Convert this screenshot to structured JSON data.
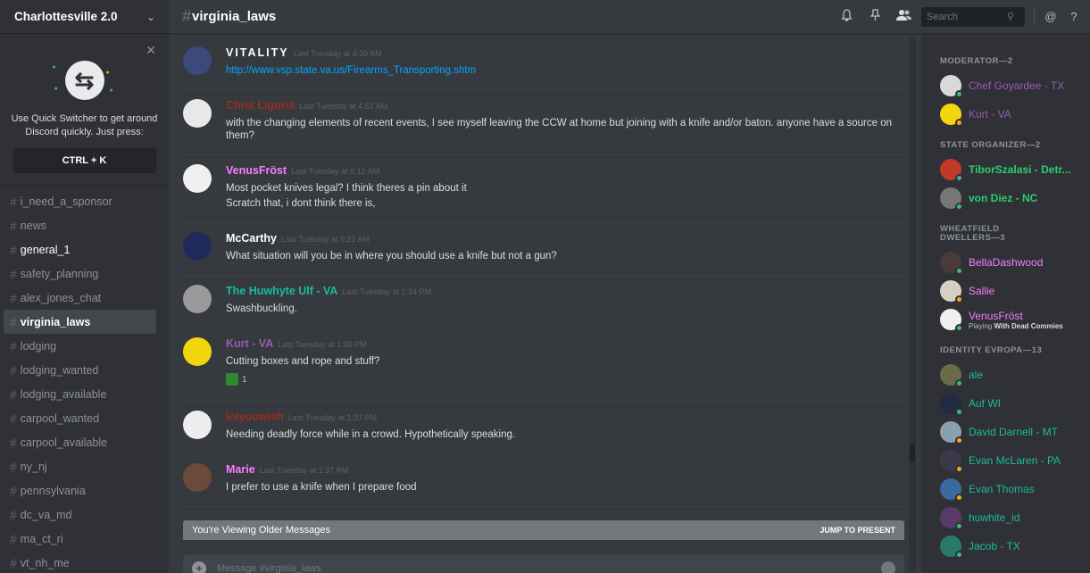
{
  "server": {
    "name": "Charlottesville 2.0"
  },
  "switcher": {
    "text": "Use Quick Switcher to get around Discord quickly. Just press:",
    "shortcut": "CTRL + K"
  },
  "channels": [
    {
      "name": "i_need_a_sponsor",
      "state": "normal"
    },
    {
      "name": "news",
      "state": "normal"
    },
    {
      "name": "general_1",
      "state": "unread"
    },
    {
      "name": "safety_planning",
      "state": "normal"
    },
    {
      "name": "alex_jones_chat",
      "state": "normal"
    },
    {
      "name": "virginia_laws",
      "state": "active"
    },
    {
      "name": "lodging",
      "state": "normal"
    },
    {
      "name": "lodging_wanted",
      "state": "normal"
    },
    {
      "name": "lodging_available",
      "state": "normal"
    },
    {
      "name": "carpool_wanted",
      "state": "normal"
    },
    {
      "name": "carpool_available",
      "state": "normal"
    },
    {
      "name": "ny_nj",
      "state": "normal"
    },
    {
      "name": "pennsylvania",
      "state": "normal"
    },
    {
      "name": "dc_va_md",
      "state": "normal"
    },
    {
      "name": "ma_ct_ri",
      "state": "normal"
    },
    {
      "name": "vt_nh_me",
      "state": "normal"
    }
  ],
  "topbar": {
    "channel": "virginia_laws",
    "search_placeholder": "Search",
    "icons": [
      "bell-icon",
      "pin-icon",
      "members-icon",
      "search-icon",
      "at-icon",
      "help-icon"
    ]
  },
  "messages": [
    {
      "author": "VITALITY",
      "color": "#ffffff",
      "timestamp": "Last Tuesday at 4:39 AM",
      "lines": [],
      "link": "http://www.vsp.state.va.us/Firearms_Transporting.shtm",
      "avatar": "#3b4a7a",
      "spaced": true
    },
    {
      "author": "Chris Liguria",
      "color": "#992d22",
      "timestamp": "Last Tuesday at 4:52 AM",
      "lines": [
        "with the changing elements of recent events, I see myself leaving the CCW at home but joining with a knife and/or baton. anyone have a source on them?"
      ],
      "avatar": "#e8e8e8"
    },
    {
      "author": "VenusFröst",
      "color": "#f47fff",
      "timestamp": "Last Tuesday at 5:12 AM",
      "lines": [
        "Most pocket knives legal? I think theres a pin about it",
        "Scratch that, i dont think there is,"
      ],
      "avatar": "#f0f0f0"
    },
    {
      "author": "McCarthy",
      "color": "#ffffff",
      "timestamp": "Last Tuesday at 5:21 AM",
      "lines": [
        "What situation will you be in where you should use a knife but not a gun?"
      ],
      "avatar": "#1e2a5a"
    },
    {
      "author": "The Huwhyte Ulf - VA",
      "color": "#1abc9c",
      "timestamp": "Last Tuesday at 1:34 PM",
      "lines": [
        "Swashbuckling."
      ],
      "avatar": "#9a9a9a"
    },
    {
      "author": "Kurt - VA",
      "color": "#9b59b6",
      "timestamp": "Last Tuesday at 1:36 PM",
      "lines": [
        "Cutting boxes and rope and stuff?"
      ],
      "reaction_count": "1",
      "avatar": "#f2d60d"
    },
    {
      "author": "lolyouwish",
      "color": "#992d22",
      "timestamp": "Last Tuesday at 1:37 PM",
      "lines": [
        "Needing deadly force while in a crowd. Hypothetically speaking."
      ],
      "avatar": "#eeeeee"
    },
    {
      "author": "Marie",
      "color": "#f47fff",
      "timestamp": "Last Tuesday at 1:37 PM",
      "lines": [
        "I prefer to use a knife when I prepare food"
      ],
      "avatar": "#6b4a3a"
    }
  ],
  "older_bar": {
    "text": "You're Viewing Older Messages",
    "jump": "JUMP TO PRESENT"
  },
  "composer": {
    "placeholder": "Message #virginia_laws"
  },
  "member_groups": [
    {
      "title": "MODERATOR—2",
      "members": [
        {
          "name": "Chef Goyardee - TX",
          "color": "#9b59b6",
          "status": "#43b581",
          "avatar": "#d9d9d9"
        },
        {
          "name": "Kurt - VA",
          "color": "#9b59b6",
          "status": "#faa61a",
          "avatar": "#f2d60d"
        }
      ]
    },
    {
      "title": "STATE ORGANIZER—2",
      "members": [
        {
          "name": "TiborSzalasi - Detr...",
          "color": "#2ecc71",
          "status": "#43b581",
          "avatar": "#c0392b",
          "bold": true
        },
        {
          "name": "von Diez - NC",
          "color": "#2ecc71",
          "status": "#43b581",
          "avatar": "#777777",
          "bold": true
        }
      ]
    },
    {
      "title": "WHEATFIELD DWELLERS—3",
      "members": [
        {
          "name": "BellaDashwood",
          "color": "#f47fff",
          "status": "#43b581",
          "avatar": "#4a3a3a"
        },
        {
          "name": "Sallie",
          "color": "#f47fff",
          "status": "#faa61a",
          "avatar": "#d8cfc4"
        },
        {
          "name": "VenusFröst",
          "color": "#f47fff",
          "status": "#43b581",
          "avatar": "#f0f0f0",
          "activity_prefix": "Playing",
          "activity": "With Dead Commies"
        }
      ]
    },
    {
      "title": "IDENTITY EVROPA—13",
      "members": [
        {
          "name": "ale",
          "color": "#1abc9c",
          "status": "#43b581",
          "avatar": "#6b6b4a"
        },
        {
          "name": "Auf WI",
          "color": "#1abc9c",
          "status": "#43b581",
          "avatar": "#222a44"
        },
        {
          "name": "David Darnell - MT",
          "color": "#1abc9c",
          "status": "#faa61a",
          "avatar": "#8aa0b0"
        },
        {
          "name": "Evan McLaren - PA",
          "color": "#1abc9c",
          "status": "#faa61a",
          "avatar": "#3a3a4a"
        },
        {
          "name": "Evan Thomas",
          "color": "#1abc9c",
          "status": "#faa61a",
          "avatar": "#3a6aa0"
        },
        {
          "name": "huwhite_id",
          "color": "#1abc9c",
          "status": "#43b581",
          "avatar": "#5a3a6a"
        },
        {
          "name": "Jacob - TX",
          "color": "#1abc9c",
          "status": "#43b581",
          "avatar": "#2a7a6a"
        }
      ]
    }
  ]
}
